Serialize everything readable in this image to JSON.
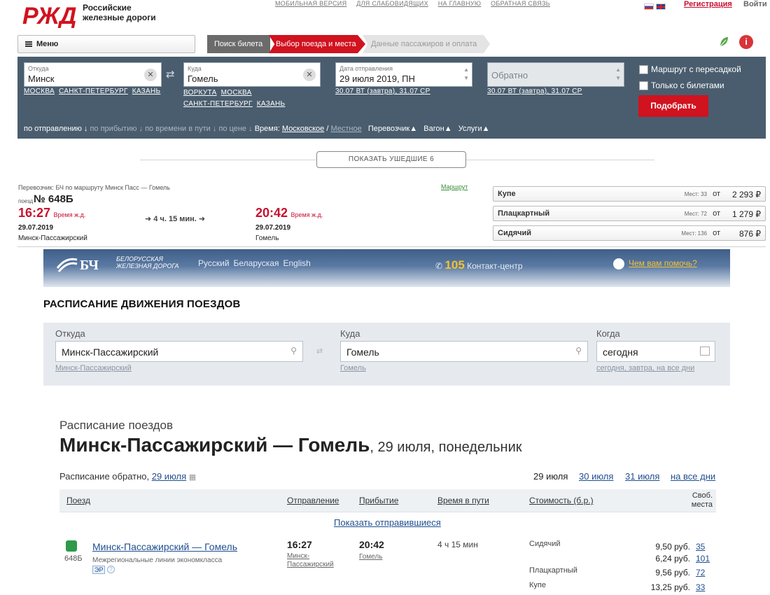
{
  "rzd": {
    "brand_line1": "Российские",
    "brand_line2": "железные дороги",
    "toplinks": [
      "МОБИЛЬНАЯ ВЕРСИЯ",
      "ДЛЯ СЛАБОВИДЯЩИХ",
      "НА ГЛАВНУЮ",
      "ОБРАТНАЯ СВЯЗЬ"
    ],
    "register": "Регистрация",
    "login": "Войти",
    "menu": "Меню",
    "steps": [
      "Поиск билета",
      "Выбор поезда и места",
      "Данные пассажиров и оплата"
    ],
    "info_glyph": "i",
    "from": {
      "label": "Откуда",
      "value": "Минск",
      "quick": [
        "МОСКВА",
        "САНКТ-ПЕТЕРБУРГ",
        "КАЗАНЬ"
      ]
    },
    "to": {
      "label": "Куда",
      "value": "Гомель",
      "quick": [
        "ВОРКУТА",
        "МОСКВА",
        "САНКТ-ПЕТЕРБУРГ",
        "КАЗАНЬ"
      ]
    },
    "date": {
      "label": "Дата отправления",
      "value": "29 июля 2019, ПН",
      "quick": "30.07 ВТ (завтра), 31.07 СР"
    },
    "return": {
      "placeholder": "Обратно",
      "quick": "30.07 ВТ (завтра), 31.07 СР"
    },
    "checks": [
      "Маршрут с пересадкой",
      "Только с билетами"
    ],
    "find_button": "Подобрать",
    "sort": {
      "by_departure": "по отправлению",
      "by_arrival": "по прибытию",
      "by_travel_time": "по времени в пути",
      "by_price": "по цене",
      "time_label": "Время:",
      "time_moscow": "Московское",
      "time_local": "Местное",
      "carrier": "Перевозчик",
      "car": "Вагон",
      "services": "Услуги"
    },
    "show_gone": "ПОКАЗАТЬ УШЕДШИЕ 6",
    "train": {
      "meta": "Перевозчик: БЧ   по маршруту Минск Пасс — Гомель",
      "route_link": "Маршрут",
      "label": "поезд",
      "number": "№ 648Б",
      "dep_time": "16:27",
      "arr_time": "20:42",
      "time_note": "Время ж.д.",
      "dep_date": "29.07.2019",
      "arr_date": "29.07.2019",
      "dep_station": "Минск-Пассажирский",
      "arr_station": "Гомель",
      "duration": "4 ч. 15 мин."
    },
    "fares": [
      {
        "name": "Купе",
        "seats": "Мест: 33",
        "from": "от",
        "price": "2 293 ₽"
      },
      {
        "name": "Плацкартный",
        "seats": "Мест: 72",
        "from": "от",
        "price": "1 279 ₽"
      },
      {
        "name": "Сидячий",
        "seats": "Мест: 136",
        "from": "от",
        "price": "876 ₽"
      }
    ]
  },
  "bch": {
    "logo_text": "БЧ",
    "name_line1": "БЕЛОРУССКАЯ",
    "name_line2": "ЖЕЛЕЗНАЯ ДОРОГА",
    "langs": [
      "Русский",
      "Беларуская",
      "English"
    ],
    "contact_num": "105",
    "contact_label": "Контакт-центр",
    "help": "Чем вам помочь?",
    "schedule_title": "РАСПИСАНИЕ ДВИЖЕНИЯ ПОЕЗДОВ",
    "from": {
      "label": "Откуда",
      "value": "Минск-Пассажирский",
      "hint": "Минск-Пассажирский"
    },
    "to": {
      "label": "Куда",
      "value": "Гомель",
      "hint": "Гомель"
    },
    "when": {
      "label": "Когда",
      "value": "сегодня",
      "hint": "сегодня, завтра, на все дни"
    },
    "subtitle": "Расписание поездов",
    "title_bold": "Минск-Пассажирский — Гомель",
    "title_rest": ", 29 июля, понедельник",
    "back_sched_label": "Расписание обратно,",
    "back_sched_date": "29 июля",
    "days": {
      "current": "29 июля",
      "d2": "30 июля",
      "d3": "31 июля",
      "all": "на все дни"
    },
    "columns": [
      "Поезд",
      "Отправление",
      "Прибытие",
      "Время в пути",
      "Стоимость (б.р.)",
      "Своб. места"
    ],
    "show_departed": "Показать отправившиеся",
    "row": {
      "num": "648Б",
      "route": "Минск-Пассажирский — Гомель",
      "class": "Межрегиональные линии экономкласса",
      "tag": "ЭР",
      "dep_time": "16:27",
      "dep_station": "Минск-Пассажирский",
      "arr_time": "20:42",
      "arr_station": "Гомель",
      "duration": "4 ч 15 мин",
      "fares": [
        {
          "cls": "Сидячий",
          "price": "9,50 руб.",
          "seats": "35"
        },
        {
          "cls": "",
          "price": "6,24 руб.",
          "seats": "101"
        },
        {
          "cls": "Плацкартный",
          "price": "9,56 руб.",
          "seats": "72"
        },
        {
          "cls": "Купе",
          "price": "13,25 руб.",
          "seats": "33"
        }
      ]
    }
  }
}
